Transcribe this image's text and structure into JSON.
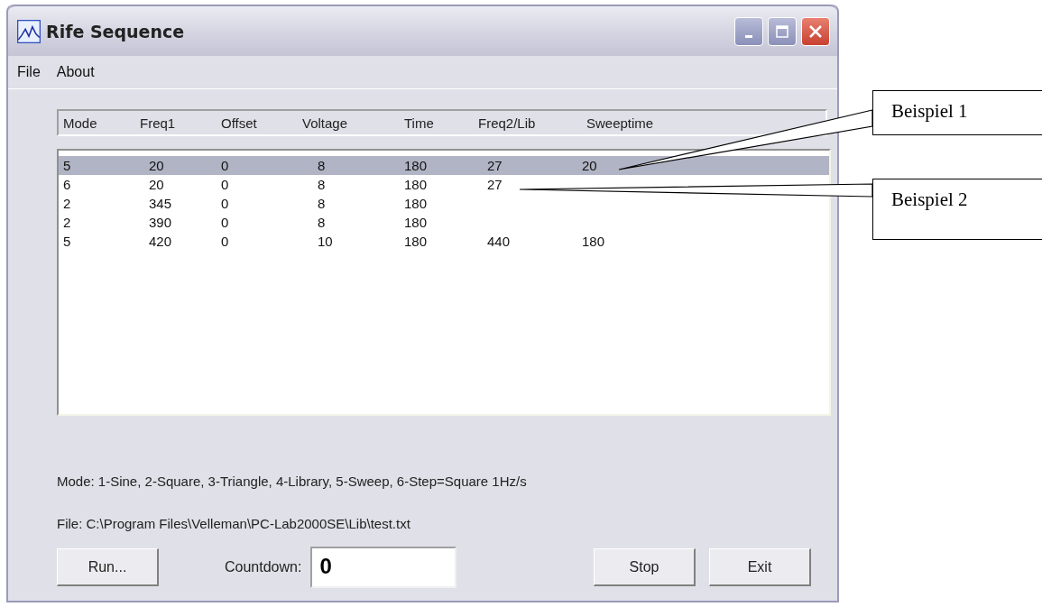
{
  "window": {
    "title": "Rife Sequence"
  },
  "menu": [
    "File",
    "About"
  ],
  "columns": [
    "Mode",
    "Freq1",
    "Offset",
    "Voltage",
    "Time",
    "Freq2/Lib",
    "Sweeptime"
  ],
  "rows": [
    {
      "selected": true,
      "cells": [
        "5",
        "20",
        "0",
        "8",
        "180",
        "27",
        "20"
      ]
    },
    {
      "selected": false,
      "cells": [
        "6",
        "20",
        "0",
        "8",
        "180",
        "27"
      ]
    },
    {
      "selected": false,
      "cells": [
        "2",
        "345",
        "0",
        "8",
        "180"
      ]
    },
    {
      "selected": false,
      "cells": [
        "2",
        "390",
        "0",
        "8",
        "180"
      ]
    },
    {
      "selected": false,
      "cells": [
        "5",
        "420",
        "0",
        "10",
        "180",
        "440",
        "180"
      ]
    }
  ],
  "mode_legend": "Mode:  1-Sine,  2-Square,  3-Triangle,  4-Library,  5-Sweep,  6-Step=Square  1Hz/s",
  "file_line": "File:  C:\\Program Files\\Velleman\\PC-Lab2000SE\\Lib\\test.txt",
  "buttons": {
    "run": "Run...",
    "stop": "Stop",
    "exit": "Exit"
  },
  "countdown": {
    "label": "Countdown:",
    "value": "0"
  },
  "callouts": [
    "Beispiel 1",
    "Beispiel 2"
  ]
}
